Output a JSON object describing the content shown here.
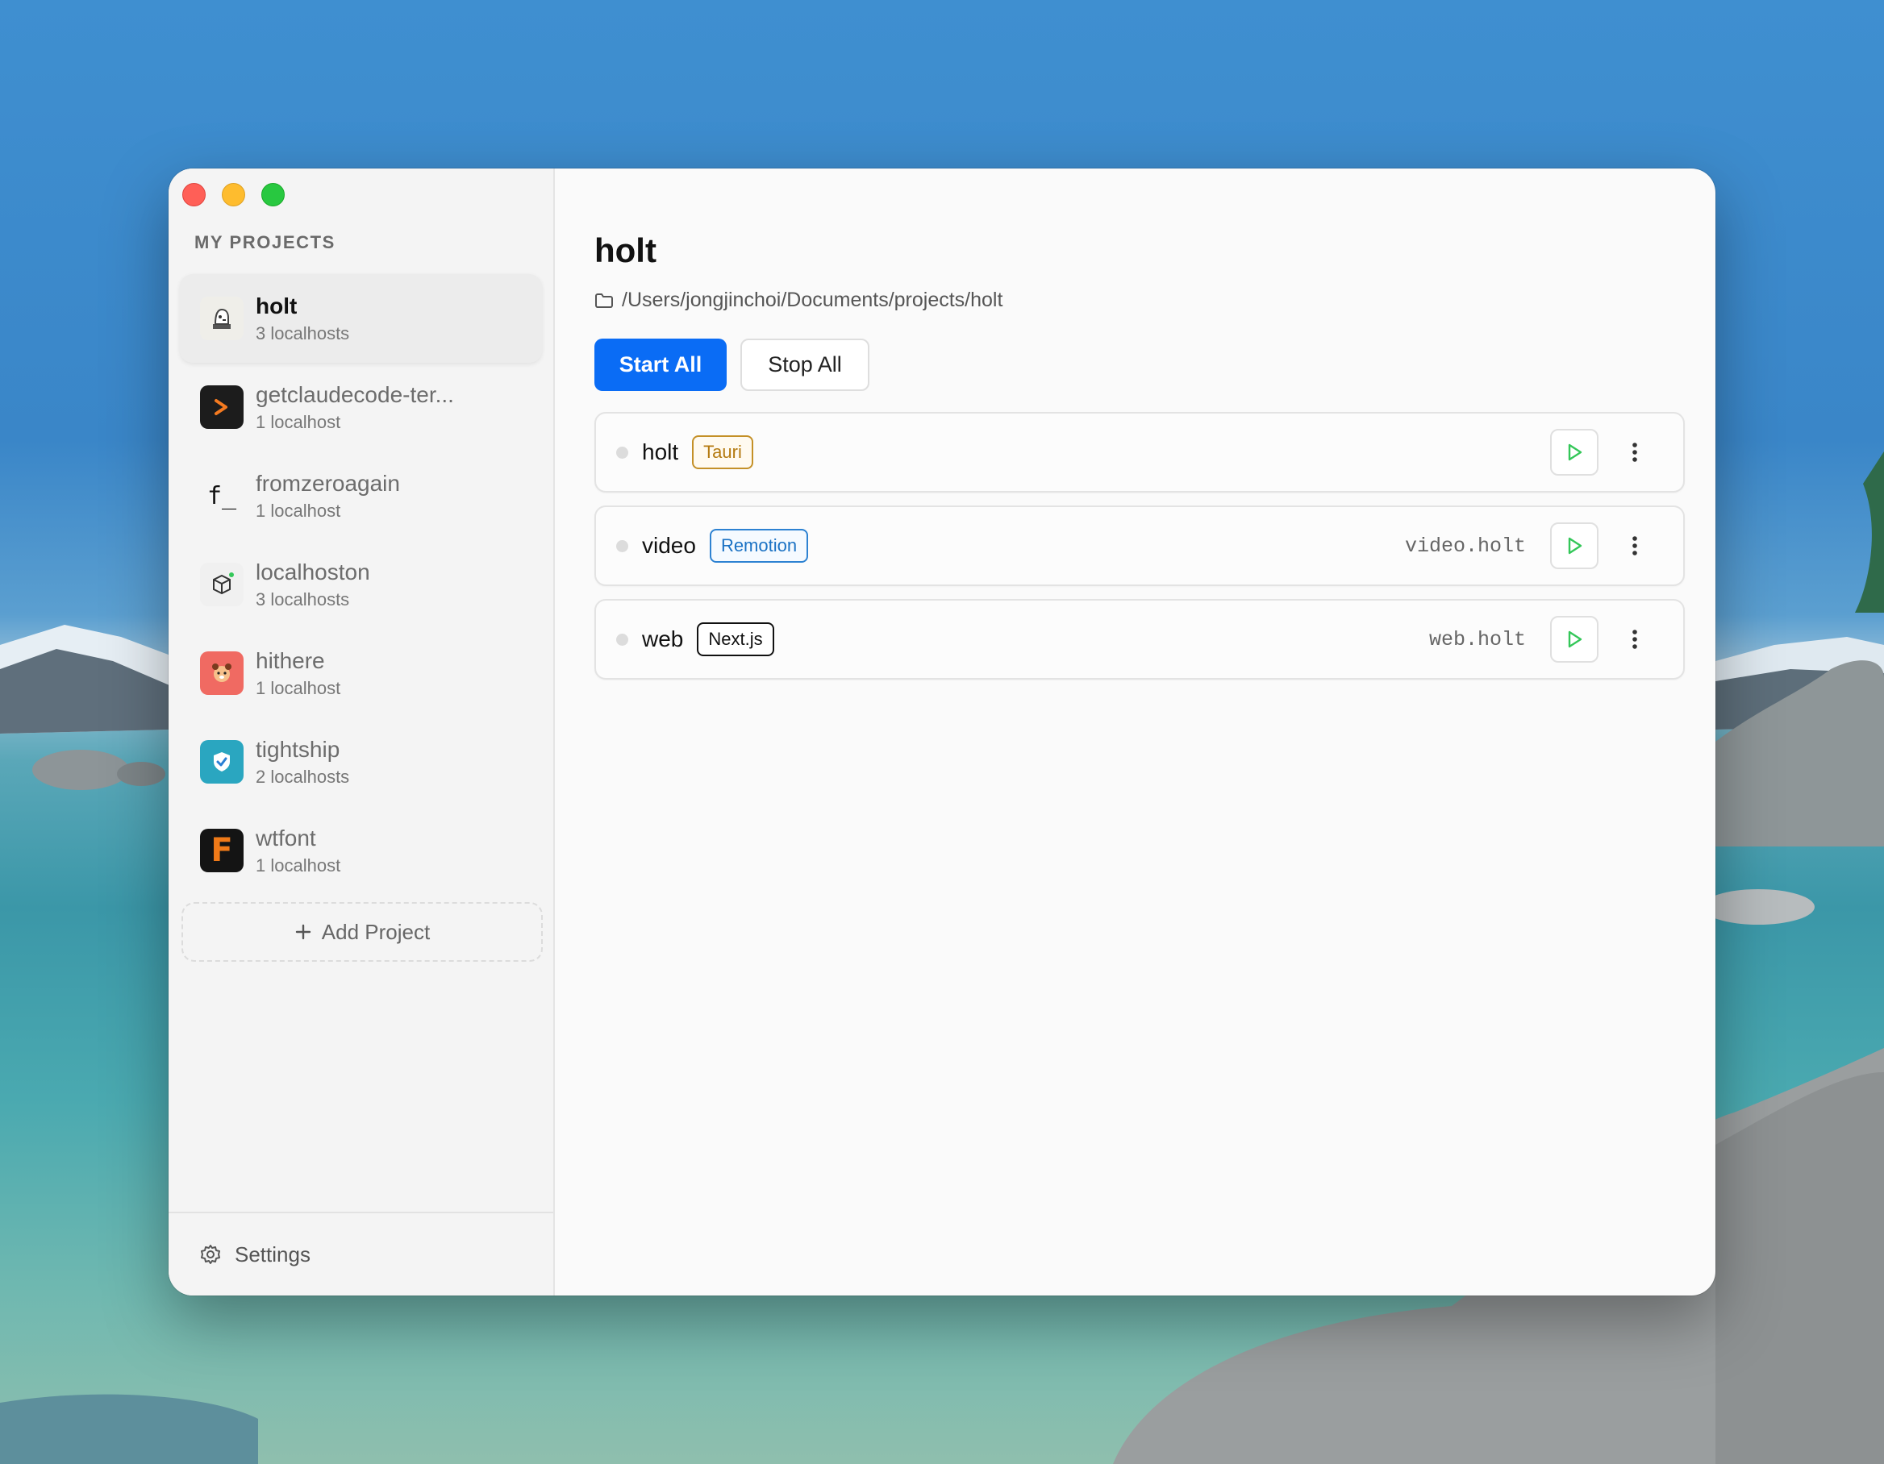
{
  "sidebar": {
    "section_label": "MY PROJECTS",
    "projects": [
      {
        "name": "holt",
        "sub": "3 localhosts",
        "icon": "holt-logo-icon",
        "active": true
      },
      {
        "name": "getclaudecode-ter...",
        "sub": "1 localhost",
        "icon": "terminal-prompt-icon"
      },
      {
        "name": "fromzeroagain",
        "sub": "1 localhost",
        "icon": "f-underscore-icon",
        "glyph": "f_"
      },
      {
        "name": "localhoston",
        "sub": "3 localhosts",
        "icon": "cube-icon"
      },
      {
        "name": "hithere",
        "sub": "1 localhost",
        "icon": "red-panda-icon"
      },
      {
        "name": "tightship",
        "sub": "2 localhosts",
        "icon": "shield-check-icon"
      },
      {
        "name": "wtfont",
        "sub": "1 localhost",
        "icon": "wtfont-f-icon",
        "glyph": "F"
      }
    ],
    "add_project": "Add Project",
    "settings": "Settings"
  },
  "main": {
    "title": "holt",
    "path": "/Users/jongjinchoi/Documents/projects/holt",
    "start_all": "Start All",
    "stop_all": "Stop All",
    "services": [
      {
        "name": "holt",
        "tag": "Tauri",
        "domain": ""
      },
      {
        "name": "video",
        "tag": "Remotion",
        "domain": "video.holt"
      },
      {
        "name": "web",
        "tag": "Next.js",
        "domain": "web.holt"
      }
    ]
  },
  "colors": {
    "accent": "#0a6cf5",
    "play": "#34c759",
    "tauri": "#b47a10",
    "remotion": "#1b72c4",
    "next": "#111111"
  }
}
